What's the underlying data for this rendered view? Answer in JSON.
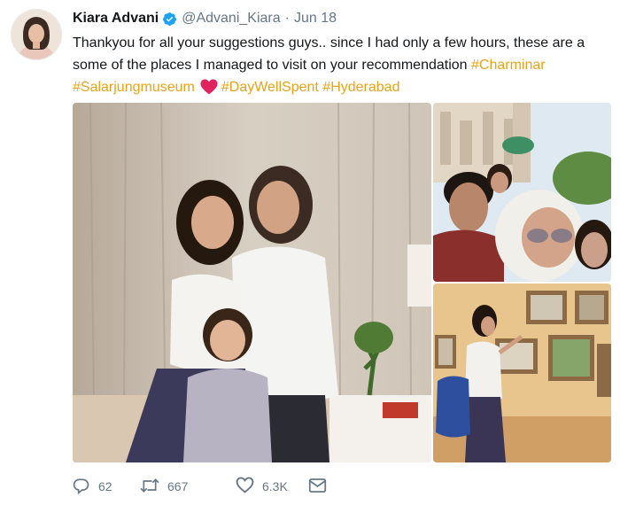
{
  "tweet": {
    "author": {
      "name": "Kiara Advani",
      "handle": "@Advani_Kiara",
      "separator": "·",
      "date": "Jun 18",
      "verified": true
    },
    "text": {
      "line1": "Thankyou for all your suggestions guys.. since I had only a few hours, these are a",
      "line2_prefix": "some of the places I managed to visit on your recommendation ",
      "hashtags": [
        "#Charminar",
        "#Salarjungmuseum",
        "#DayWellSpent",
        "#Hyderabad"
      ]
    },
    "media": [
      {
        "icon": "photo-group-portrait"
      },
      {
        "icon": "photo-selfie-charminar"
      },
      {
        "icon": "photo-museum-gallery"
      }
    ],
    "actions": {
      "reply_count": "62",
      "retweet_count": "667",
      "like_count": "6.3K",
      "dm_icon": "envelope-icon"
    },
    "colors": {
      "hashtag": "#e8a317",
      "heart": "#e0245e",
      "verified": "#1da1f2",
      "secondary_text": "#657786"
    }
  }
}
